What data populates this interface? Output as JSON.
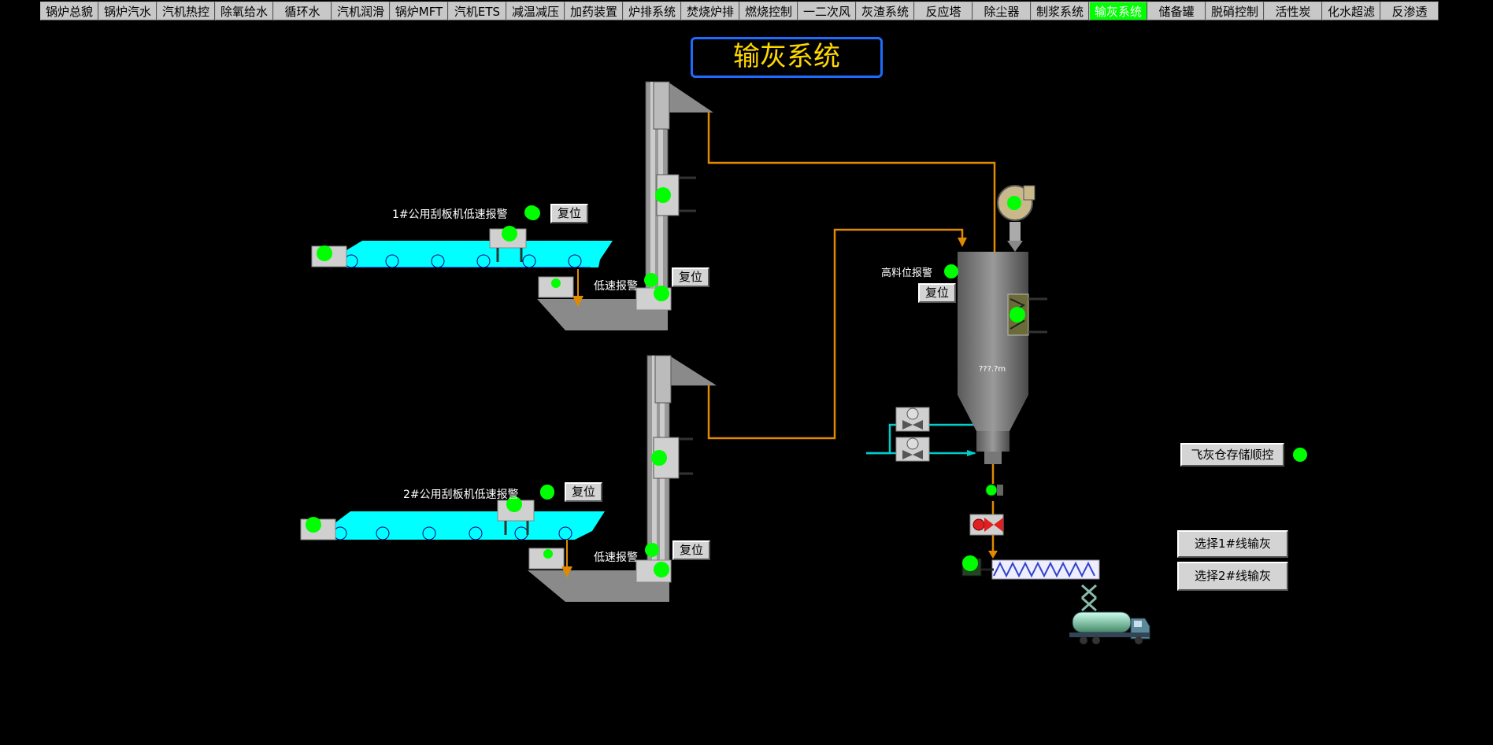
{
  "nav": {
    "tabs": [
      {
        "label": "锅炉总貌",
        "active": false
      },
      {
        "label": "锅炉汽水",
        "active": false
      },
      {
        "label": "汽机热控",
        "active": false
      },
      {
        "label": "除氧给水",
        "active": false
      },
      {
        "label": "循环水",
        "active": false
      },
      {
        "label": "汽机润滑",
        "active": false
      },
      {
        "label": "锅炉MFT",
        "active": false
      },
      {
        "label": "汽机ETS",
        "active": false
      },
      {
        "label": "减温减压",
        "active": false
      },
      {
        "label": "加药装置",
        "active": false
      },
      {
        "label": "炉排系统",
        "active": false
      },
      {
        "label": "焚烧炉排",
        "active": false
      },
      {
        "label": "燃烧控制",
        "active": false
      },
      {
        "label": "一二次风",
        "active": false
      },
      {
        "label": "灰渣系统",
        "active": false
      },
      {
        "label": "反应塔",
        "active": false
      },
      {
        "label": "除尘器",
        "active": false
      },
      {
        "label": "制浆系统",
        "active": false
      },
      {
        "label": "输灰系统",
        "active": true
      },
      {
        "label": "储备罐",
        "active": false
      },
      {
        "label": "脱硝控制",
        "active": false
      },
      {
        "label": "活性炭",
        "active": false
      },
      {
        "label": "化水超滤",
        "active": false
      },
      {
        "label": "反渗透",
        "active": false
      }
    ]
  },
  "page_title": "输灰系统",
  "conveyor1": {
    "alarm_label": "1#公用刮板机低速报警",
    "reset_label": "复位"
  },
  "conveyor2": {
    "alarm_label": "2#公用刮板机低速报警",
    "reset_label": "复位"
  },
  "elevator1": {
    "low_speed_label": "低速报警",
    "reset_label": "复位"
  },
  "elevator2": {
    "low_speed_label": "低速报警",
    "reset_label": "复位"
  },
  "silo": {
    "high_level_label": "高料位报警",
    "reset_label": "复位",
    "level_readout": "???.?m"
  },
  "controls": {
    "sequence_label": "飞灰仓存储顺控",
    "line1_label": "选择1#线输灰",
    "line2_label": "选择2#线输灰"
  },
  "colors": {
    "cyan": "#00ffff",
    "orange": "#e08a00",
    "green": "#00ff00",
    "gray": "#8a8a8a",
    "active_tab": "#00ff00",
    "title_border": "#1e6bff",
    "title_text": "#ffd800"
  }
}
